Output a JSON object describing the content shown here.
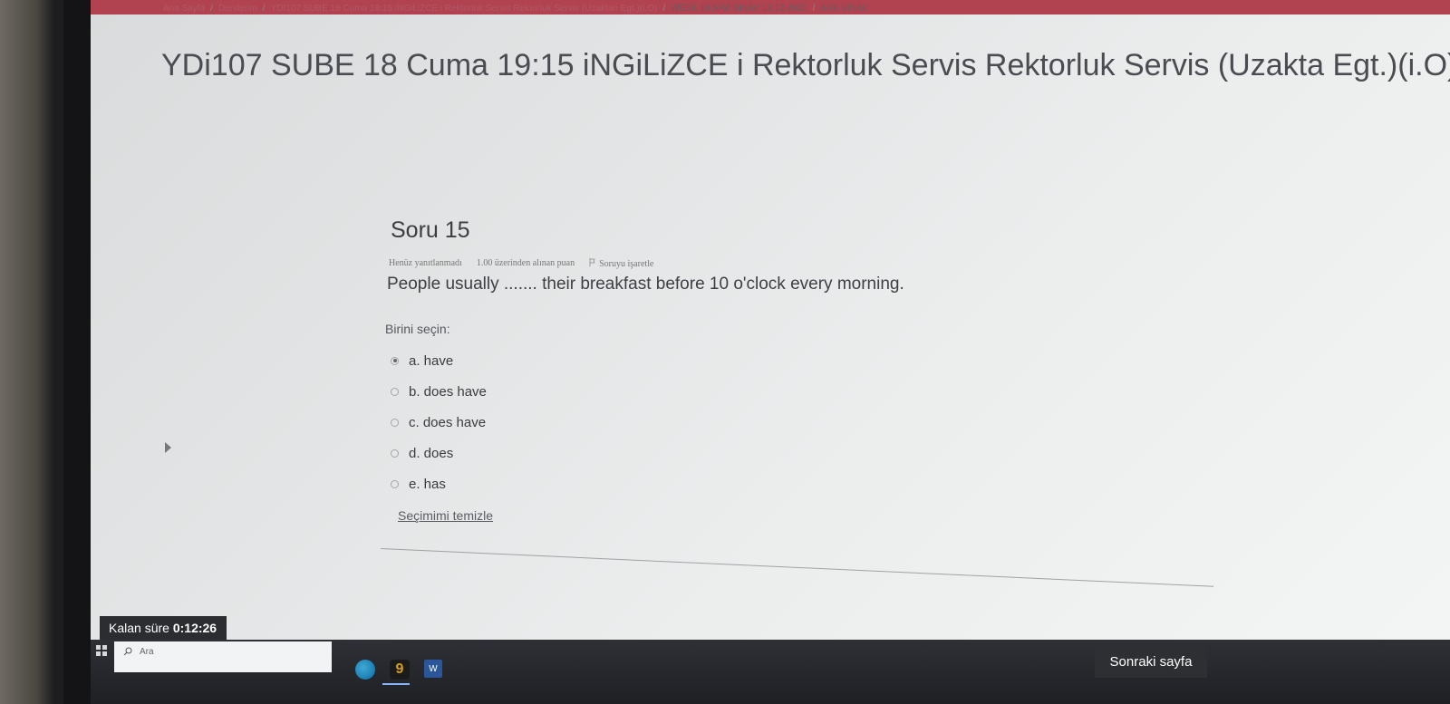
{
  "breadcrumb": [
    {
      "label": "Ana Sayfa"
    },
    {
      "label": "Derslerim"
    },
    {
      "label": "YDİ107 SUBE 18 Cuma 19:15 iNGiLiZCE i Rektorluk Servis Rektorluk Servis (Uzaktan Egt.)(i.O)"
    },
    {
      "label": "WEEK 10 ARA SINAV 12.12.2020"
    },
    {
      "label": "ARA SINAV"
    }
  ],
  "breadcrumb_separator": "/",
  "course_title": "YDi107 SUBE 18 Cuma 19:15 iNGiLiZCE i Rektorluk Servis Rektorluk Servis (Uzakta Egt.)(i.O)",
  "question": {
    "number_label": "Soru 15",
    "status": "Henüz yanıtlanmadı",
    "mark": "1.00 üzerinden alınan puan",
    "flag_label": "Soruyu işaretle",
    "text": "People usually ....... their breakfast before 10 o'clock every morning.",
    "select_label": "Birini seçin:",
    "options": [
      {
        "label": "a. have",
        "selected": true
      },
      {
        "label": "b. does have",
        "selected": false
      },
      {
        "label": "c. does have",
        "selected": false
      },
      {
        "label": "d. does",
        "selected": false
      },
      {
        "label": "e. has",
        "selected": false
      }
    ],
    "clear_label": "Seçimimi temizle"
  },
  "timer": {
    "label": "Kalan süre",
    "value": "0:12:26"
  },
  "next_button": "Sonraki sayfa",
  "taskbar": {
    "search_placeholder": "Ara",
    "word_icon_label": "W"
  }
}
